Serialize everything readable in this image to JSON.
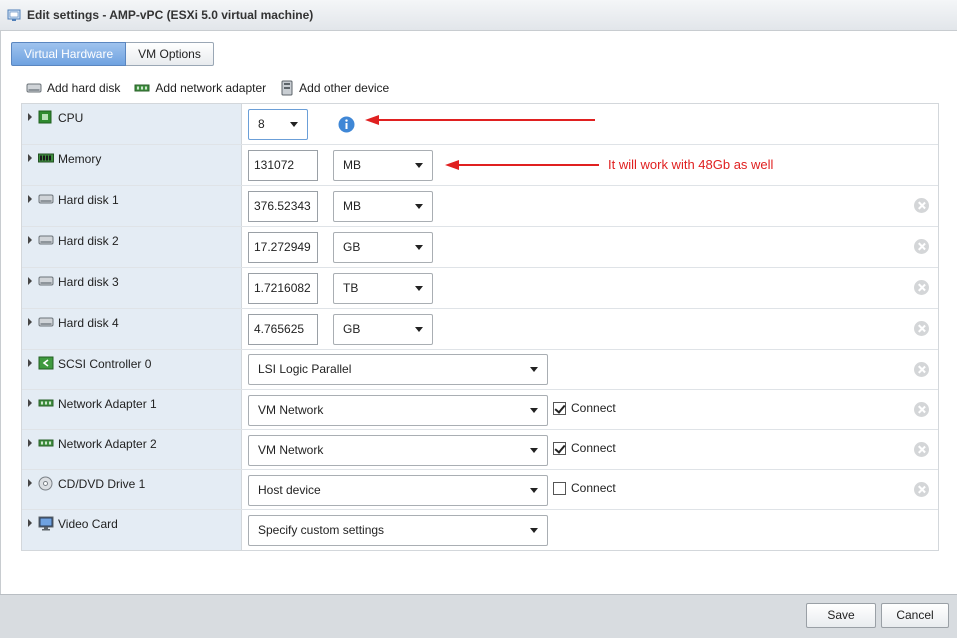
{
  "window": {
    "title": "Edit settings - AMP-vPC (ESXi 5.0 virtual machine)"
  },
  "tabs": [
    {
      "label": "Virtual Hardware",
      "active": true
    },
    {
      "label": "VM Options",
      "active": false
    }
  ],
  "toolbar": {
    "add_hard_disk": "Add hard disk",
    "add_network_adapter": "Add network adapter",
    "add_other_device": "Add other device"
  },
  "rows": {
    "cpu": {
      "label": "CPU",
      "value": "8",
      "icon": "cpu-chip-icon"
    },
    "memory": {
      "label": "Memory",
      "value": "131072",
      "unit": "MB",
      "icon": "memory-module-icon"
    },
    "hd1": {
      "label": "Hard disk 1",
      "value": "376.52343",
      "unit": "MB",
      "icon": "hard-disk-icon"
    },
    "hd2": {
      "label": "Hard disk 2",
      "value": "17.272949",
      "unit": "GB",
      "icon": "hard-disk-icon"
    },
    "hd3": {
      "label": "Hard disk 3",
      "value": "1.7216082",
      "unit": "TB",
      "icon": "hard-disk-icon"
    },
    "hd4": {
      "label": "Hard disk 4",
      "value": "4.765625",
      "unit": "GB",
      "icon": "hard-disk-icon"
    },
    "scsi": {
      "label": "SCSI Controller 0",
      "value": "LSI Logic Parallel",
      "icon": "scsi-controller-icon"
    },
    "net1": {
      "label": "Network Adapter 1",
      "value": "VM Network",
      "connect_label": "Connect",
      "connected": true,
      "icon": "network-adapter-icon"
    },
    "net2": {
      "label": "Network Adapter 2",
      "value": "VM Network",
      "connect_label": "Connect",
      "connected": true,
      "icon": "network-adapter-icon"
    },
    "cd": {
      "label": "CD/DVD Drive 1",
      "value": "Host device",
      "connect_label": "Connect",
      "connected": false,
      "icon": "cd-dvd-icon"
    },
    "video": {
      "label": "Video Card",
      "value": "Specify custom settings",
      "icon": "monitor-icon"
    }
  },
  "annotation": {
    "text": "It will work with 48Gb as well",
    "color": "#e02020"
  },
  "footer": {
    "save": "Save",
    "cancel": "Cancel"
  },
  "colors": {
    "accent": "#6fa2e0",
    "label_column": "#e4ecf4",
    "annotation": "#e02020"
  }
}
